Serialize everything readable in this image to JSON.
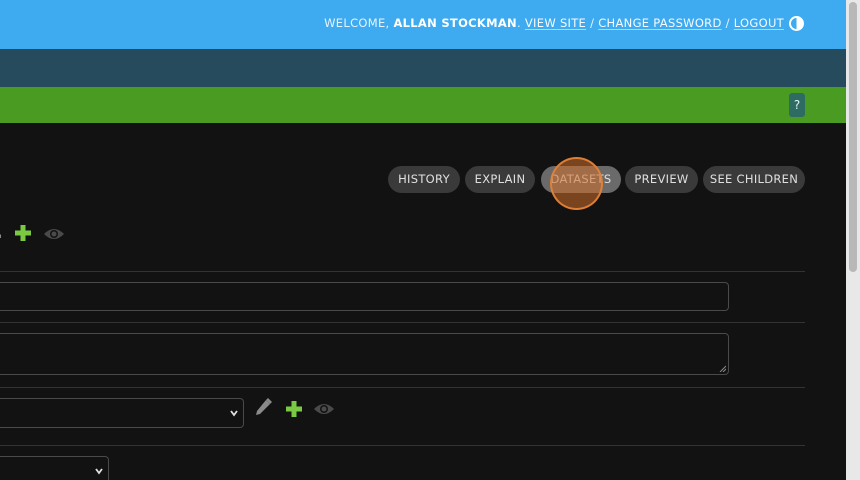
{
  "header": {
    "welcome_prefix": "WELCOME, ",
    "user_name": "ALLAN STOCKMAN",
    "view_site": "VIEW SITE",
    "change_password": "CHANGE PASSWORD",
    "logout": "LOGOUT",
    "separator_after_name": ". ",
    "separator": " / ",
    "theme_toggle_icon": "half-circle-icon"
  },
  "message_bar": {
    "help_label": "?"
  },
  "object_tools": {
    "history": "HISTORY",
    "explain": "EXPLAIN",
    "datasets": "DATASETS",
    "preview": "PREVIEW",
    "see_children": "SEE CHILDREN"
  },
  "form": {
    "text_value": "",
    "textarea_value": "",
    "select_main_value": "",
    "select_bottom_value": ""
  },
  "icons": {
    "edit": "pencil-icon",
    "add": "plus-icon",
    "view": "eye-icon"
  },
  "colors": {
    "header": "#3eaaf0",
    "breadcrumbs": "#264b5d",
    "message_bar": "#4a9b22",
    "add_icon": "#7ac943",
    "background": "#121212"
  }
}
